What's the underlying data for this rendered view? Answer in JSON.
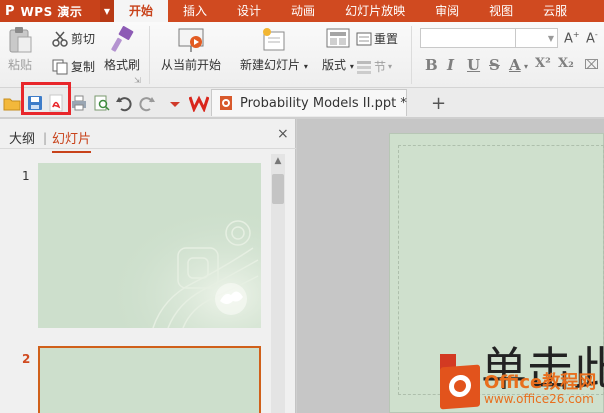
{
  "app": {
    "logo": "P",
    "name": "WPS 演示"
  },
  "tabs": [
    "开始",
    "插入",
    "设计",
    "动画",
    "幻灯片放映",
    "审阅",
    "视图",
    "云服"
  ],
  "ribbon": {
    "paste": "粘贴",
    "cut": "剪切",
    "copy": "复制",
    "format_painter": "格式刷",
    "from_current": "从当前开始",
    "new_slide": "新建幻灯片",
    "layout": "版式",
    "reset": "重置",
    "section": "节",
    "format_buttons": [
      "B",
      "I",
      "U",
      "S",
      "A",
      "X²",
      "X₂"
    ]
  },
  "quick_access": {
    "document_tab_title": "Probability Models II.ppt *",
    "add_tab": "+"
  },
  "left_pane": {
    "tab_outline": "大纲",
    "tab_slides": "幻灯片",
    "divider": "|",
    "close": "×",
    "slides": [
      {
        "number": "1"
      },
      {
        "number": "2"
      }
    ]
  },
  "slide": {
    "title_text": "单击此"
  },
  "watermark": {
    "text": "Office教程网",
    "url": "www.office26.com"
  },
  "colors": {
    "title_bar": "#d04a20",
    "slide_bg": "#cfe0cd",
    "highlight": "#e8262b",
    "watermark": "#e86f1e"
  }
}
